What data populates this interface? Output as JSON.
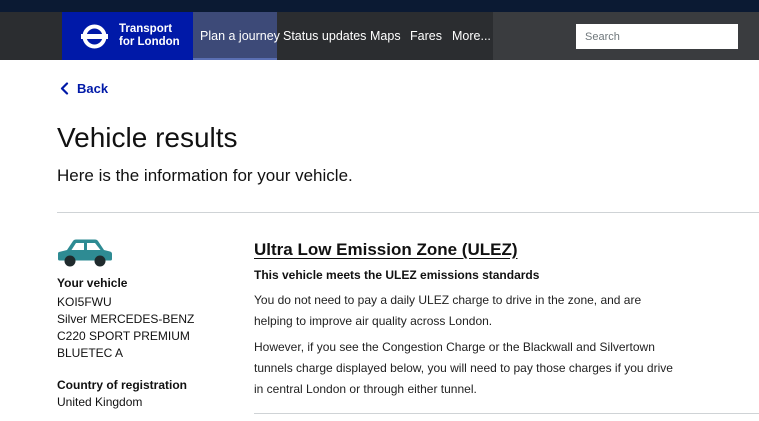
{
  "brand": {
    "line1": "Transport",
    "line2": "for London"
  },
  "nav": {
    "items": [
      {
        "label": "Plan a journey",
        "active": true
      },
      {
        "label": "Status updates",
        "active": false
      },
      {
        "label": "Maps",
        "active": false
      },
      {
        "label": "Fares",
        "active": false
      },
      {
        "label": "More...",
        "active": false
      }
    ],
    "search_placeholder": "Search"
  },
  "back_label": "Back",
  "page": {
    "title": "Vehicle results",
    "subtitle": "Here is the information for your vehicle."
  },
  "vehicle": {
    "label": "Your vehicle",
    "lines": [
      "KOI5FWU",
      "Silver MERCEDES-BENZ",
      "C220 SPORT PREMIUM",
      "BLUETEC A"
    ],
    "country_label": "Country of registration",
    "country": "United Kingdom"
  },
  "ulez": {
    "title": "Ultra Low Emission Zone (ULEZ)",
    "status": "This vehicle meets the ULEZ emissions standards",
    "para1": "You do not need to pay a daily ULEZ charge to drive in the zone, and are helping to improve air quality across London.",
    "para2": "However, if you see the Congestion Charge or the Blackwall and Silvertown tunnels charge displayed below, you will need to pay those charges if you drive in central London or through either tunnel."
  },
  "colors": {
    "brand_blue": "#0019a8",
    "nav_bg": "#2b2d30",
    "car_teal": "#2e8b93"
  },
  "icons": {
    "logo": "tfl-roundel-icon",
    "back": "chevron-left-icon",
    "vehicle": "car-icon"
  }
}
